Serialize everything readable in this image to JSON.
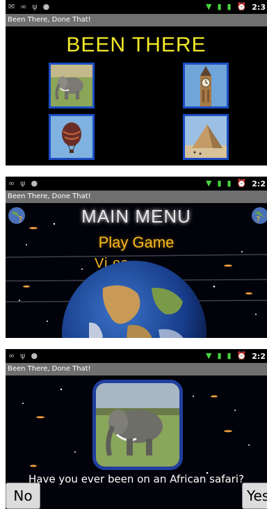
{
  "statusbar": {
    "screen1_time": "2:3",
    "screen2_time": "2:2",
    "screen3_time": "2:2"
  },
  "app_title": "Been There, Done That!",
  "screen1": {
    "heading": "BEEN THERE",
    "tiles": [
      "elephant",
      "big-ben",
      "hot-air-balloon",
      "pyramid"
    ]
  },
  "screen2": {
    "heading": "MAIN MENU",
    "play_label": "Play Game",
    "partial_label": "Vi     es"
  },
  "screen3": {
    "question": "Have you ever been on an African safari?",
    "no_label": "No",
    "yes_label": "Yes"
  },
  "colors": {
    "title_yellow": "#f2e92b",
    "menu_orange": "#f6b91f",
    "tile_border": "#1c4ec4",
    "signal_green": "#4bd641",
    "titlebar_gray": "#6f6f6f"
  }
}
